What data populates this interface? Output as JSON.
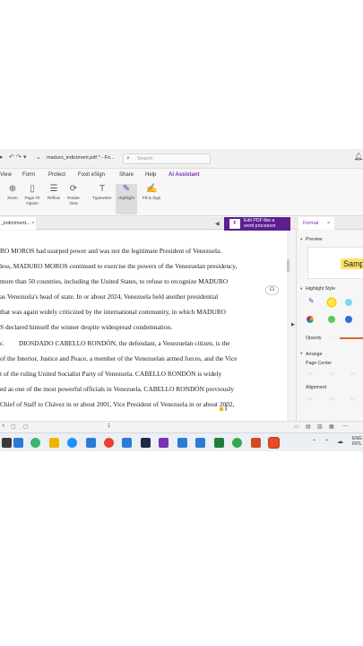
{
  "titlebar": {
    "filename": "maduro_indictment.pdf * - Fo...",
    "search_placeholder": "Search",
    "icons": [
      "hamburger-icon",
      "bell-icon",
      "search-icon"
    ]
  },
  "menu": [
    "View",
    "Form",
    "Protect",
    "Foxit eSign",
    "Share",
    "Help",
    "AI Assistant"
  ],
  "ribbon": [
    {
      "label": "Zoom",
      "icon": "zoom-icon"
    },
    {
      "label": "Page Fit Option",
      "icon": "page-fit-icon"
    },
    {
      "label": "Reflow",
      "icon": "reflow-icon"
    },
    {
      "label": "Rotate View",
      "icon": "rotate-icon"
    },
    {
      "label": "Typewriter",
      "icon": "typewriter-icon"
    },
    {
      "label": "Highlight",
      "icon": "highlight-icon"
    },
    {
      "label": "Fill & Sign",
      "icon": "fill-sign-icon"
    }
  ],
  "tabs": {
    "doc_tab": "_indictment...",
    "close": "×",
    "promo_line1": "Edit PDF like a",
    "promo_line2": "word processor",
    "format_tab": "Format",
    "format_close": "×"
  },
  "document": {
    "lines": [
      "RO MOROS had usurped power and was not the legitimate President of Venezuela.",
      "less, MADURO MOROS continued to exercise the powers of the Venezuelan presidency,",
      "more than 50 countries, including the United States, to refuse to recognize MADURO",
      "as Venezuela's head of state. In or about 2024, Venezuela held another presidential",
      "that was again widely criticized by the international community, in which MADURO",
      "S declared himself the winner despite widespread condemnation.",
      "DIOSDADO CABELLO RONDÓN, the defendant, a Venezuelan citizen, is the",
      "of the Interior, Justice and Peace, a member of the Venezuelan armed forces, and the Vice",
      "t of the ruling United Socialist Party of Venezuela. CABELLO RONDÓN is widely",
      "ed as one of the most powerful officials in Venezuela. CABELLO RONDÓN previously",
      "Chief of Staff to Chávez in or about 2001, Vice President of Venezuela in or about 2002,"
    ],
    "para_mark": "c."
  },
  "panel": {
    "preview_label": "Preview",
    "preview_sample": "Samp",
    "highlight_style": "Highlight Style",
    "opacity": "Opacity",
    "page_center": "Page Center",
    "alignment": "Alignment",
    "arrange": "Arrange",
    "swatch_colors": [
      "#ffe84d",
      "#7fd8e8",
      "#59c85f",
      "#2f6fd6"
    ]
  },
  "statusbar": {
    "page_indicator": "1"
  },
  "taskbar": {
    "lang_top": "ENG",
    "lang_bottom": "INTL",
    "icon_colors": [
      "#444",
      "#2b7bd6",
      "#3cb371",
      "#f0b400",
      "#1e90ff",
      "#2b7bd6",
      "#e94235",
      "#2b7bd6",
      "#1f2a44",
      "#2b7bd6",
      "#7b2fb5",
      "#e2492f",
      "#2b7bd6",
      "#1b7f3a",
      "#2b7bd6",
      "#34a853",
      "#d4481f",
      "#e54b2a"
    ]
  }
}
